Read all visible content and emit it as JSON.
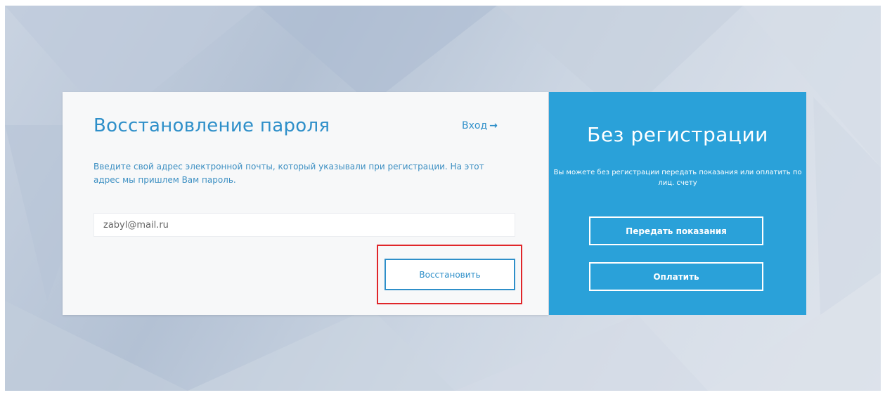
{
  "recovery": {
    "title": "Восстановление пароля",
    "login_link": "Вход",
    "login_arrow_icon": "arrow-right-icon",
    "description": "Введите свой адрес электронной почты, который указывали при регистрации. На этот адрес мы пришлем Вам пароль.",
    "email_value": "zabyl@mail.ru",
    "restore_button": "Восстановить",
    "highlight_color": "#e0262a"
  },
  "no_registration": {
    "title": "Без регистрации",
    "description": "Вы можете без регистрации передать показания или оплатить по лиц. счету",
    "submit_readings_button": "Передать показания",
    "pay_button": "Оплатить"
  },
  "colors": {
    "accent_blue": "#2aa1d9",
    "text_blue": "#2e8fc9",
    "card_background": "#f7f8f9"
  }
}
